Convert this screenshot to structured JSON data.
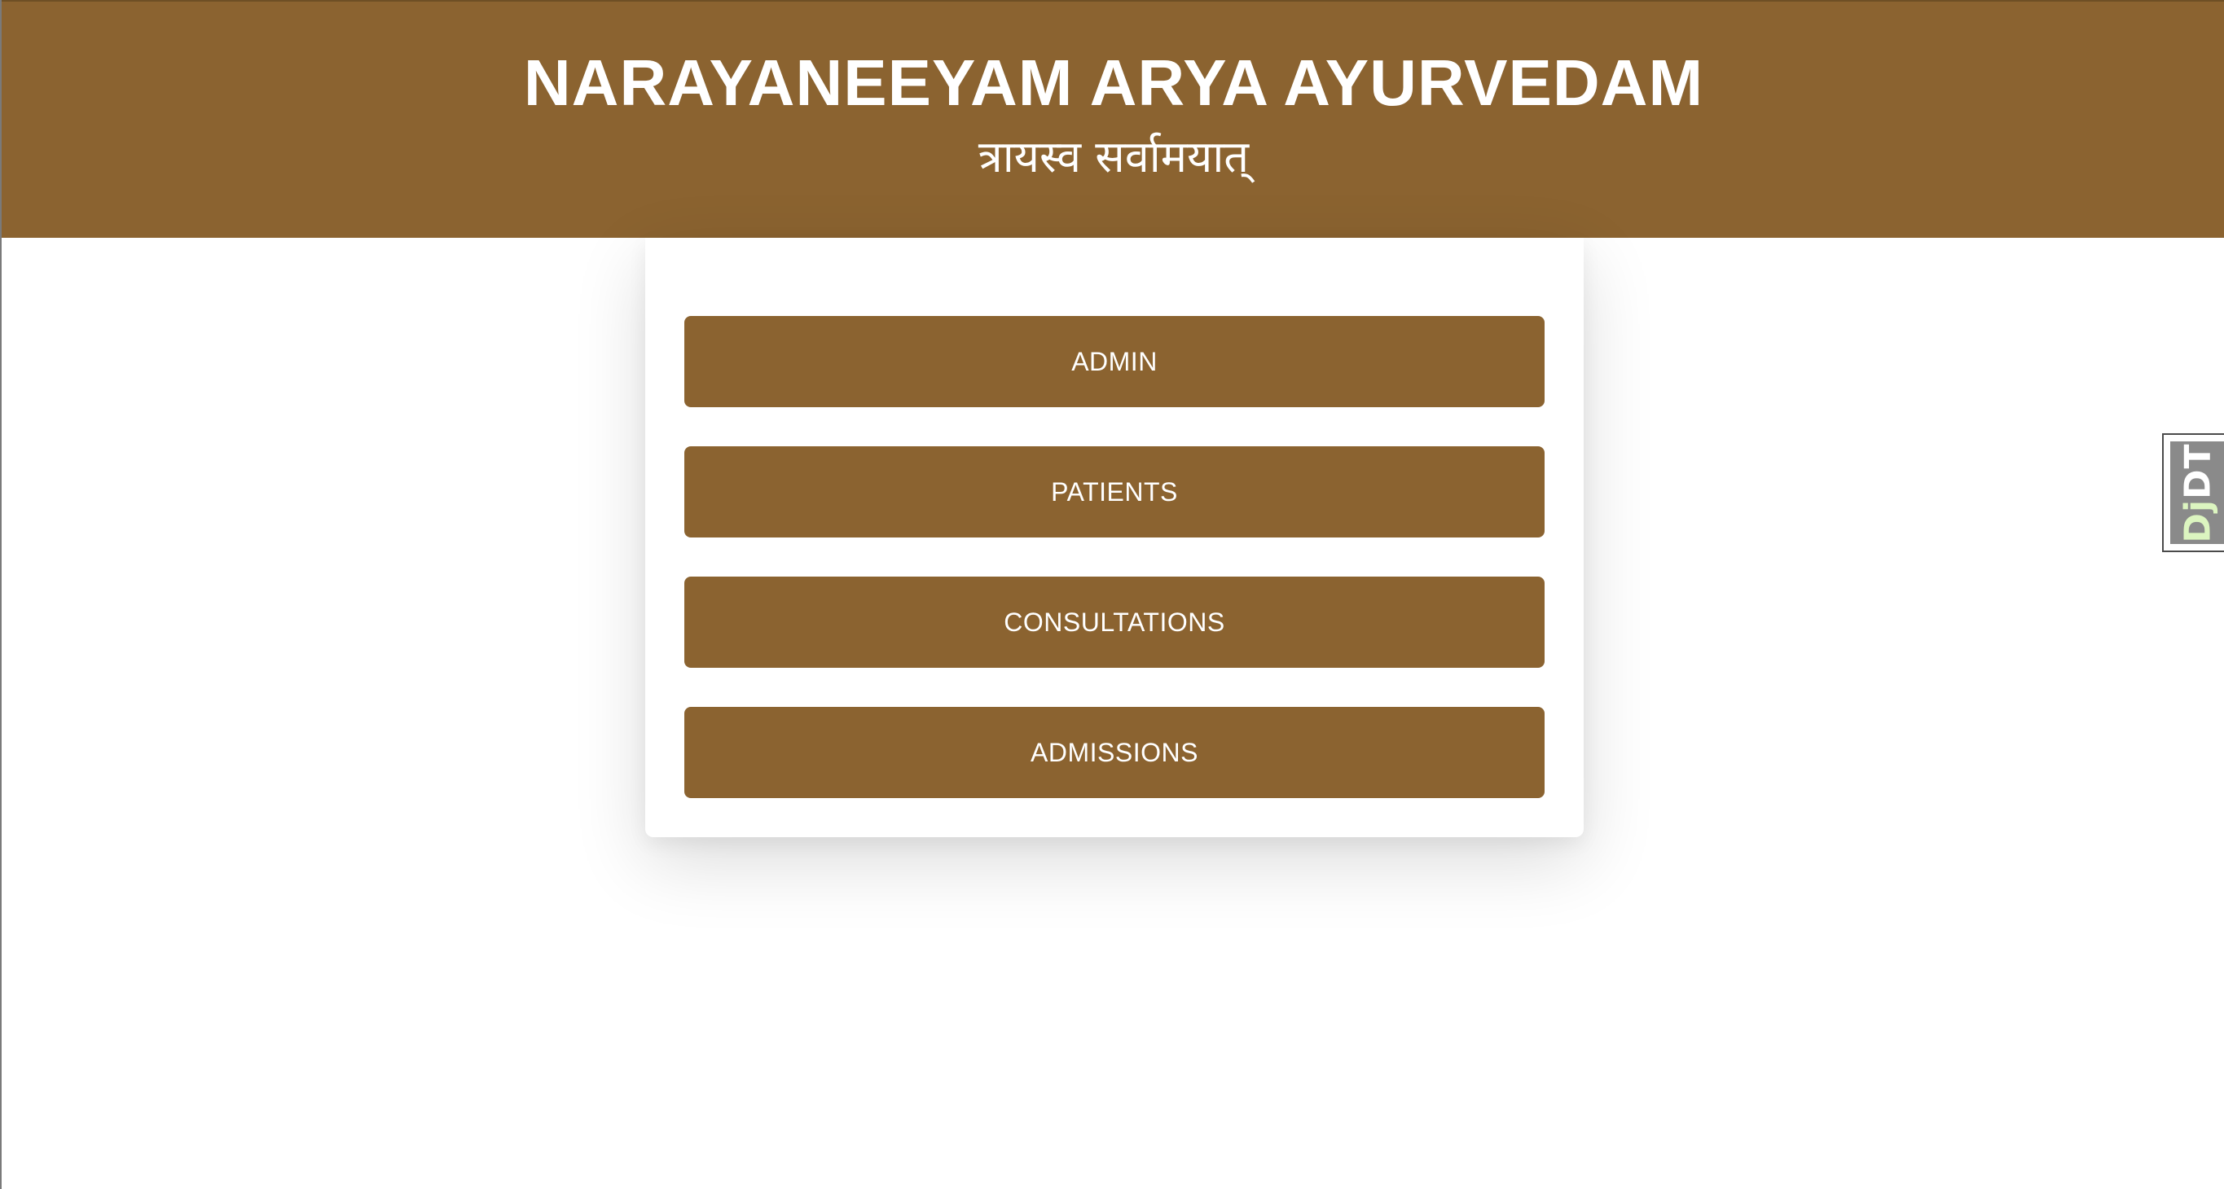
{
  "header": {
    "title": "NARAYANEEYAM ARYA AYURVEDAM",
    "tagline": "त्रायस्व सर्वामयात्"
  },
  "menu": {
    "items": [
      {
        "label": "ADMIN"
      },
      {
        "label": "PATIENTS"
      },
      {
        "label": "CONSULTATIONS"
      },
      {
        "label": "ADMISSIONS"
      }
    ]
  },
  "debug_toolbar": {
    "prefix": "Dj",
    "suffix": "DT"
  },
  "colors": {
    "brand": "#8b6330",
    "button_text": "#ffffff",
    "background": "#ffffff"
  }
}
